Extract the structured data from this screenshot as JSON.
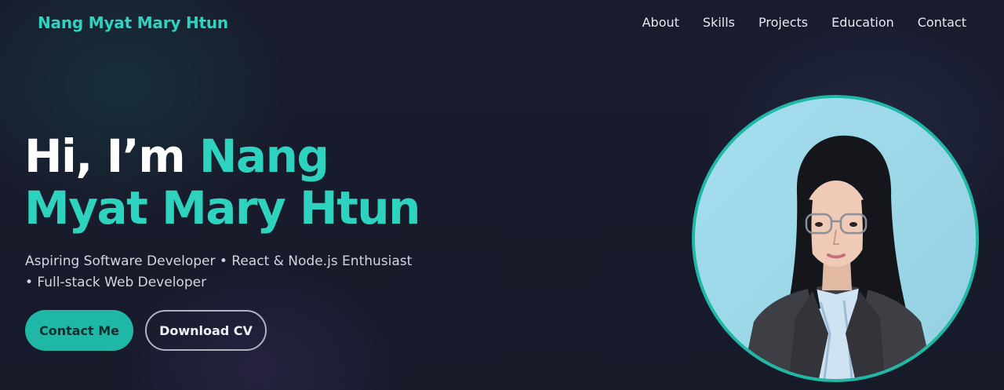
{
  "brand": {
    "name": "Nang Myat Mary Htun",
    "color": "#2ed3bf"
  },
  "nav": {
    "items": [
      {
        "label": "About"
      },
      {
        "label": "Skills"
      },
      {
        "label": "Projects"
      },
      {
        "label": "Education"
      },
      {
        "label": "Contact"
      }
    ]
  },
  "hero": {
    "greeting": "Hi, I’m ",
    "name_line1": "Nang",
    "name_line2": "Myat Mary Htun",
    "tagline_line1": "Aspiring Software Developer • React & Node.js Enthusiast",
    "tagline_line2": "• Full-stack Web Developer",
    "primary_button": "Contact Me",
    "secondary_button": "Download CV",
    "profile_photo_icon": "portrait-photo"
  },
  "colors": {
    "background": "#171a2a",
    "accent": "#2ed3bf",
    "button_fill": "#1fb8a6",
    "text": "#ffffff"
  }
}
